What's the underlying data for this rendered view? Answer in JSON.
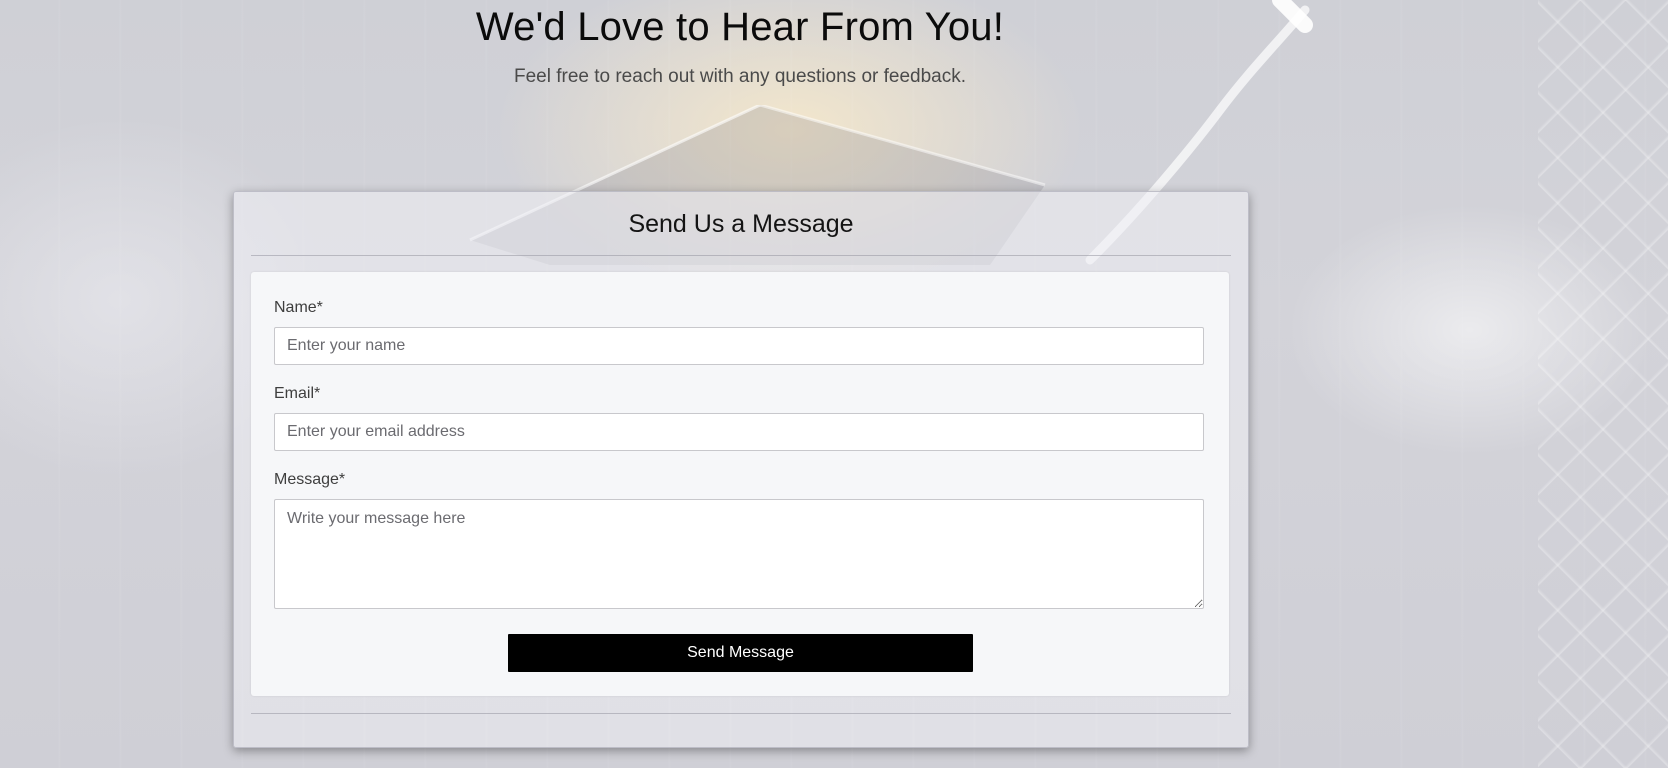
{
  "hero": {
    "title": "We'd Love to Hear From You!",
    "subtitle": "Feel free to reach out with any questions or feedback."
  },
  "contact_form": {
    "title": "Send Us a Message",
    "fields": {
      "name": {
        "label": "Name*",
        "placeholder": "Enter your name",
        "value": ""
      },
      "email": {
        "label": "Email*",
        "placeholder": "Enter your email address",
        "value": ""
      },
      "message": {
        "label": "Message*",
        "placeholder": "Write your message here",
        "value": ""
      }
    },
    "submit_label": "Send Message"
  },
  "colors": {
    "button_background": "#000000",
    "button_text": "#ffffff",
    "panel_background": "#f6f7f9",
    "page_background": "#d1d1d7"
  }
}
